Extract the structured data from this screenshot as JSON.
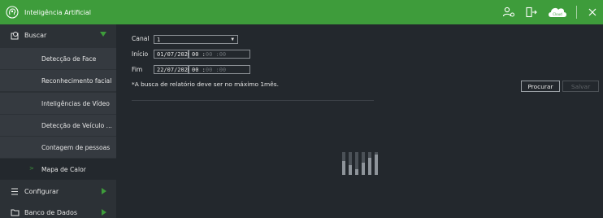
{
  "app": {
    "title": "Inteligência Artificial"
  },
  "titlebar_icons": [
    "users-icon",
    "logout-icon",
    "cloud-icon",
    "close-icon"
  ],
  "cloud_badge_text": "Cloud",
  "sidebar": {
    "search": {
      "label": "Buscar",
      "icon": "search-icon",
      "expanded": true
    },
    "items": [
      {
        "label": "Detecção de Face"
      },
      {
        "label": "Reconhecimento facial"
      },
      {
        "label": "Inteligências de Vídeo"
      },
      {
        "label": "Detecção de Veículo ..."
      },
      {
        "label": "Contagem de pessoas"
      },
      {
        "label": "Mapa de Calor",
        "active": true
      }
    ],
    "configure": {
      "label": "Configurar",
      "icon": "config-icon"
    },
    "database": {
      "label": "Banco de Dados",
      "icon": "database-icon"
    }
  },
  "form": {
    "channel_label": "Canal",
    "channel_value": "1",
    "start_label": "Início",
    "start_date": "01/07/2020",
    "start_time_hh": "00 :",
    "start_time_rest": "00 :00",
    "end_label": "Fim",
    "end_date": "22/07/2020",
    "end_time_hh": "00 :",
    "end_time_rest": "00 :00",
    "note": "*A busca de relatório deve ser no máximo 1mês."
  },
  "buttons": {
    "search": "Procurar",
    "save": "Salvar"
  },
  "placeholder_icon": "bar-chart-icon",
  "colors": {
    "accent": "#3e9c3b",
    "background": "#23282d",
    "sidebar": "#2c3136"
  }
}
